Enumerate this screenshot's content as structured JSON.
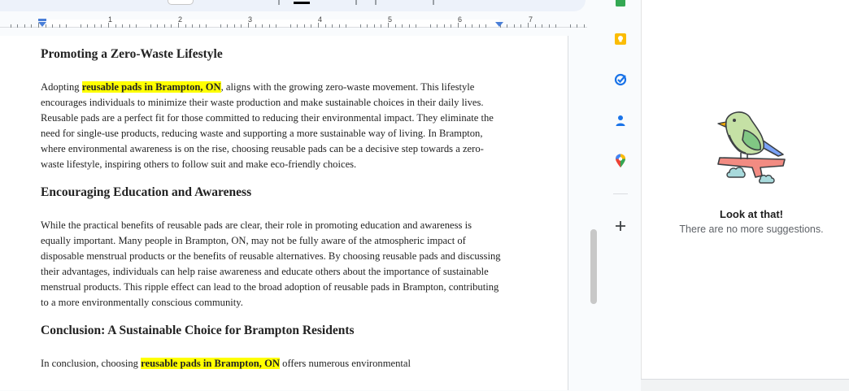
{
  "ruler": {
    "numbers": [
      "1",
      "2",
      "3",
      "4",
      "5",
      "6",
      "7"
    ]
  },
  "document": {
    "sections": [
      {
        "heading": "Promoting a Zero-Waste Lifestyle",
        "paragraph": {
          "pre": "Adopting ",
          "highlight": "reusable pads in Brampton, ON",
          "post": ", aligns with the growing zero-waste movement. This lifestyle encourages individuals to minimize their waste production and make sustainable choices in their daily lives. Reusable pads are a perfect fit for those committed to reducing their environmental impact. They eliminate the need for single-use products, reducing waste and supporting a more sustainable way of living. In Brampton, where environmental awareness is on the rise, choosing reusable pads can be a decisive step towards a zero-waste lifestyle, inspiring others to follow suit and make eco-friendly choices."
        }
      },
      {
        "heading": "Encouraging Education and Awareness",
        "paragraph": {
          "text": "While the practical benefits of reusable pads are clear, their role in promoting education and awareness is equally important. Many people in Brampton, ON, may not be fully aware of the atmospheric impact of disposable menstrual products or the benefits of reusable alternatives. By choosing reusable pads and discussing their advantages, individuals can help raise awareness and educate others about the importance of sustainable menstrual products. This ripple effect can lead to the broad adoption of reusable pads in Brampton, contributing to a more environmentally conscious community."
        }
      },
      {
        "heading": "Conclusion: A Sustainable Choice for Brampton Residents",
        "paragraph": {
          "pre": "In conclusion, choosing ",
          "highlight": "reusable pads in Brampton, ON",
          "post": " offers numerous environmental"
        }
      }
    ]
  },
  "side_icons": [
    "sheets-icon",
    "keep-icon",
    "tasks-icon",
    "contacts-icon",
    "maps-icon",
    "add-icon"
  ],
  "suggestions_panel": {
    "title": "Look at that!",
    "subtitle": "There are no more suggestions."
  },
  "colors": {
    "highlight": "#ffff00",
    "keep": "#fbbc04",
    "tasks": "#1a73e8",
    "contacts": "#1a73e8",
    "ruler_marker": "#4a7fd8"
  }
}
